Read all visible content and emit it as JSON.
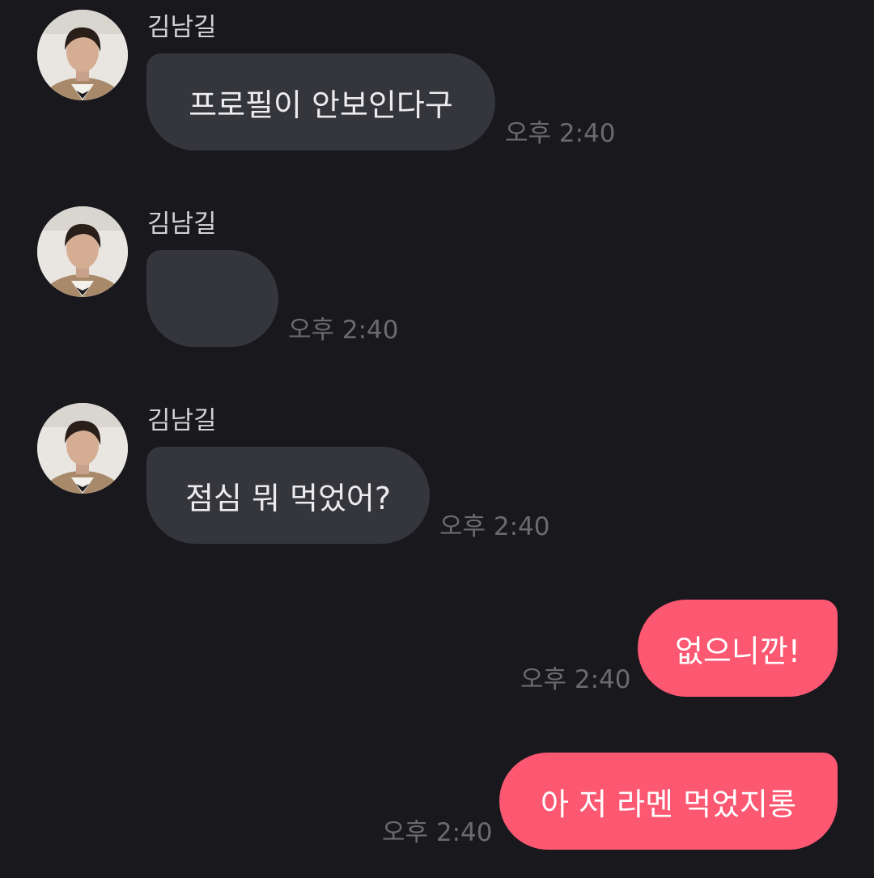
{
  "messages": [
    {
      "sender": "김남길",
      "text": "프로필이 안보인다구",
      "time": "오후 2:40"
    },
    {
      "sender": "김남길",
      "text": "",
      "time": "오후 2:40"
    },
    {
      "sender": "김남길",
      "text": "점심 뭐 먹었어?",
      "time": "오후 2:40"
    },
    {
      "text": "없으니깐!",
      "time": "오후 2:40"
    },
    {
      "text": "아 저 라멘 먹었지롱",
      "time": "오후 2:40"
    }
  ],
  "colors": {
    "background": "#18181d",
    "incoming_bubble": "#35363c",
    "outgoing_bubble": "#fd5872",
    "timestamp": "#6a6a6f"
  }
}
